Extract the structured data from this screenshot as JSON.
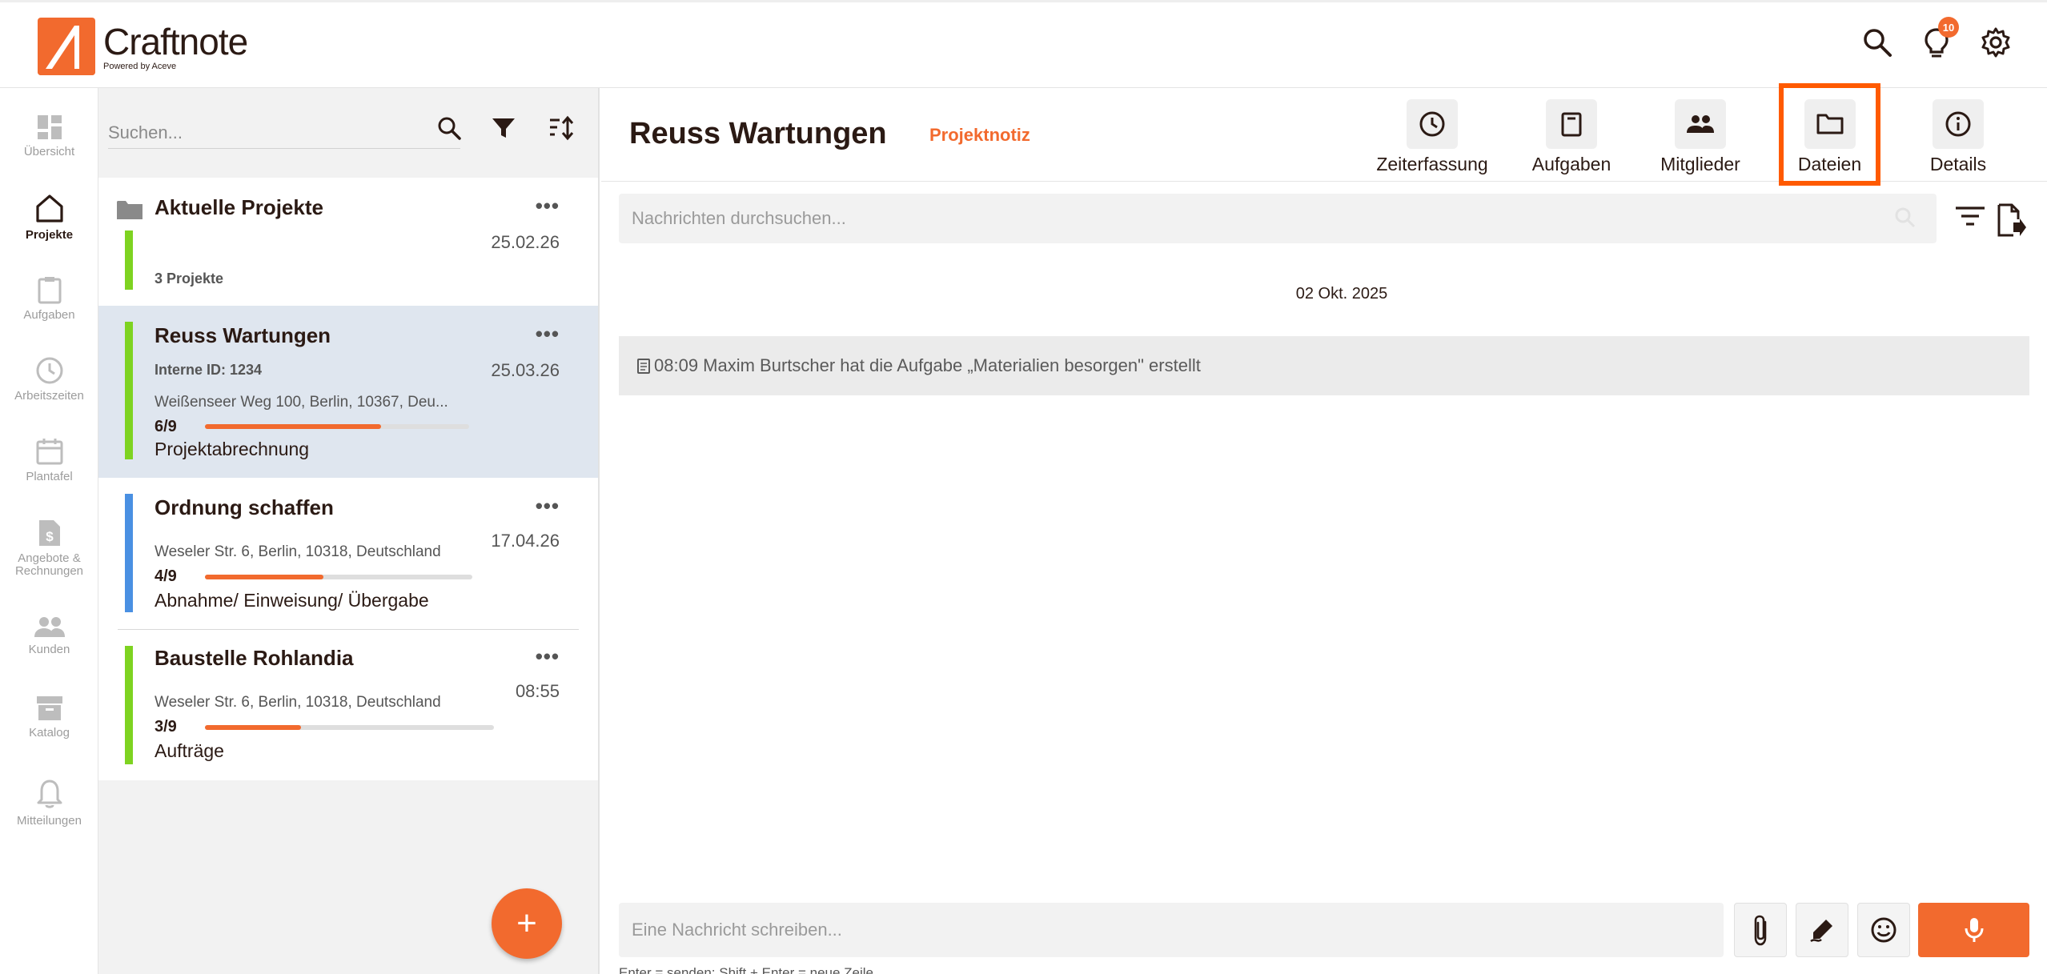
{
  "brand": {
    "name": "Craftnote",
    "tagline": "Powered by Aceve",
    "accent_color": "#f26a2e"
  },
  "top_icons": {
    "search_icon": "search-icon",
    "notifications_icon": "lightbulb-icon",
    "notifications_count": "10",
    "settings_icon": "gear-icon"
  },
  "nav": {
    "items": [
      {
        "label": "Übersicht",
        "icon": "dashboard-icon"
      },
      {
        "label": "Projekte",
        "icon": "home-icon",
        "active": true
      },
      {
        "label": "Aufgaben",
        "icon": "clipboard-icon"
      },
      {
        "label": "Arbeitszeiten",
        "icon": "clock-icon"
      },
      {
        "label": "Plantafel",
        "icon": "calendar-icon"
      },
      {
        "label": "Angebote &\nRechnungen",
        "icon": "invoice-icon"
      },
      {
        "label": "Kunden",
        "icon": "people-icon"
      },
      {
        "label": "Katalog",
        "icon": "archive-icon"
      },
      {
        "label": "Mitteilungen",
        "icon": "bell-icon"
      }
    ]
  },
  "list": {
    "search_placeholder": "Suchen...",
    "cards": [
      {
        "title": "Aktuelle Projekte",
        "date": "25.02.26",
        "sub": "3 Projekte",
        "bar_color": "#7ed321",
        "type": "folder"
      },
      {
        "title": "Reuss Wartungen",
        "date": "25.03.26",
        "internal_id": "Interne ID: 1234",
        "address": "Weißenseer Weg 100, Berlin, 10367, Deu...",
        "progress_label": "6/9",
        "progress": 0.667,
        "phase": "Projektabrechnung",
        "bar_color": "#7ed321",
        "selected": true
      },
      {
        "title": "Ordnung schaffen",
        "date": "17.04.26",
        "address": "Weseler Str. 6, Berlin, 10318, Deutschland",
        "progress_label": "4/9",
        "progress": 0.444,
        "phase": "Abnahme/ Einweisung/ Übergabe",
        "bar_color": "#4a90e2"
      },
      {
        "title": "Baustelle Rohlandia",
        "date": "08:55",
        "address": "Weseler Str. 6, Berlin, 10318, Deutschland",
        "progress_label": "3/9",
        "progress": 0.333,
        "phase": "Aufträge",
        "bar_color": "#7ed321"
      }
    ],
    "more_label": "•••",
    "add_label": "+"
  },
  "main": {
    "title": "Reuss Wartungen",
    "tag": "Projektnotiz",
    "tools": [
      {
        "label": "Zeiterfassung",
        "icon": "clock-icon"
      },
      {
        "label": "Aufgaben",
        "icon": "clipboard-icon"
      },
      {
        "label": "Mitglieder",
        "icon": "members-icon"
      },
      {
        "label": "Dateien",
        "icon": "folder-icon",
        "highlighted": true
      },
      {
        "label": "Details",
        "icon": "info-icon"
      }
    ],
    "message_search_placeholder": "Nachrichten durchsuchen...",
    "date_separator": "02 Okt. 2025",
    "events": [
      {
        "text": "08:09 Maxim Burtscher hat die Aufgabe „Materialien besorgen\" erstellt",
        "icon": "task-icon"
      }
    ],
    "composer_placeholder": "Eine Nachricht schreiben...",
    "composer_hint": "Enter = senden; Shift + Enter = neue Zeile"
  }
}
